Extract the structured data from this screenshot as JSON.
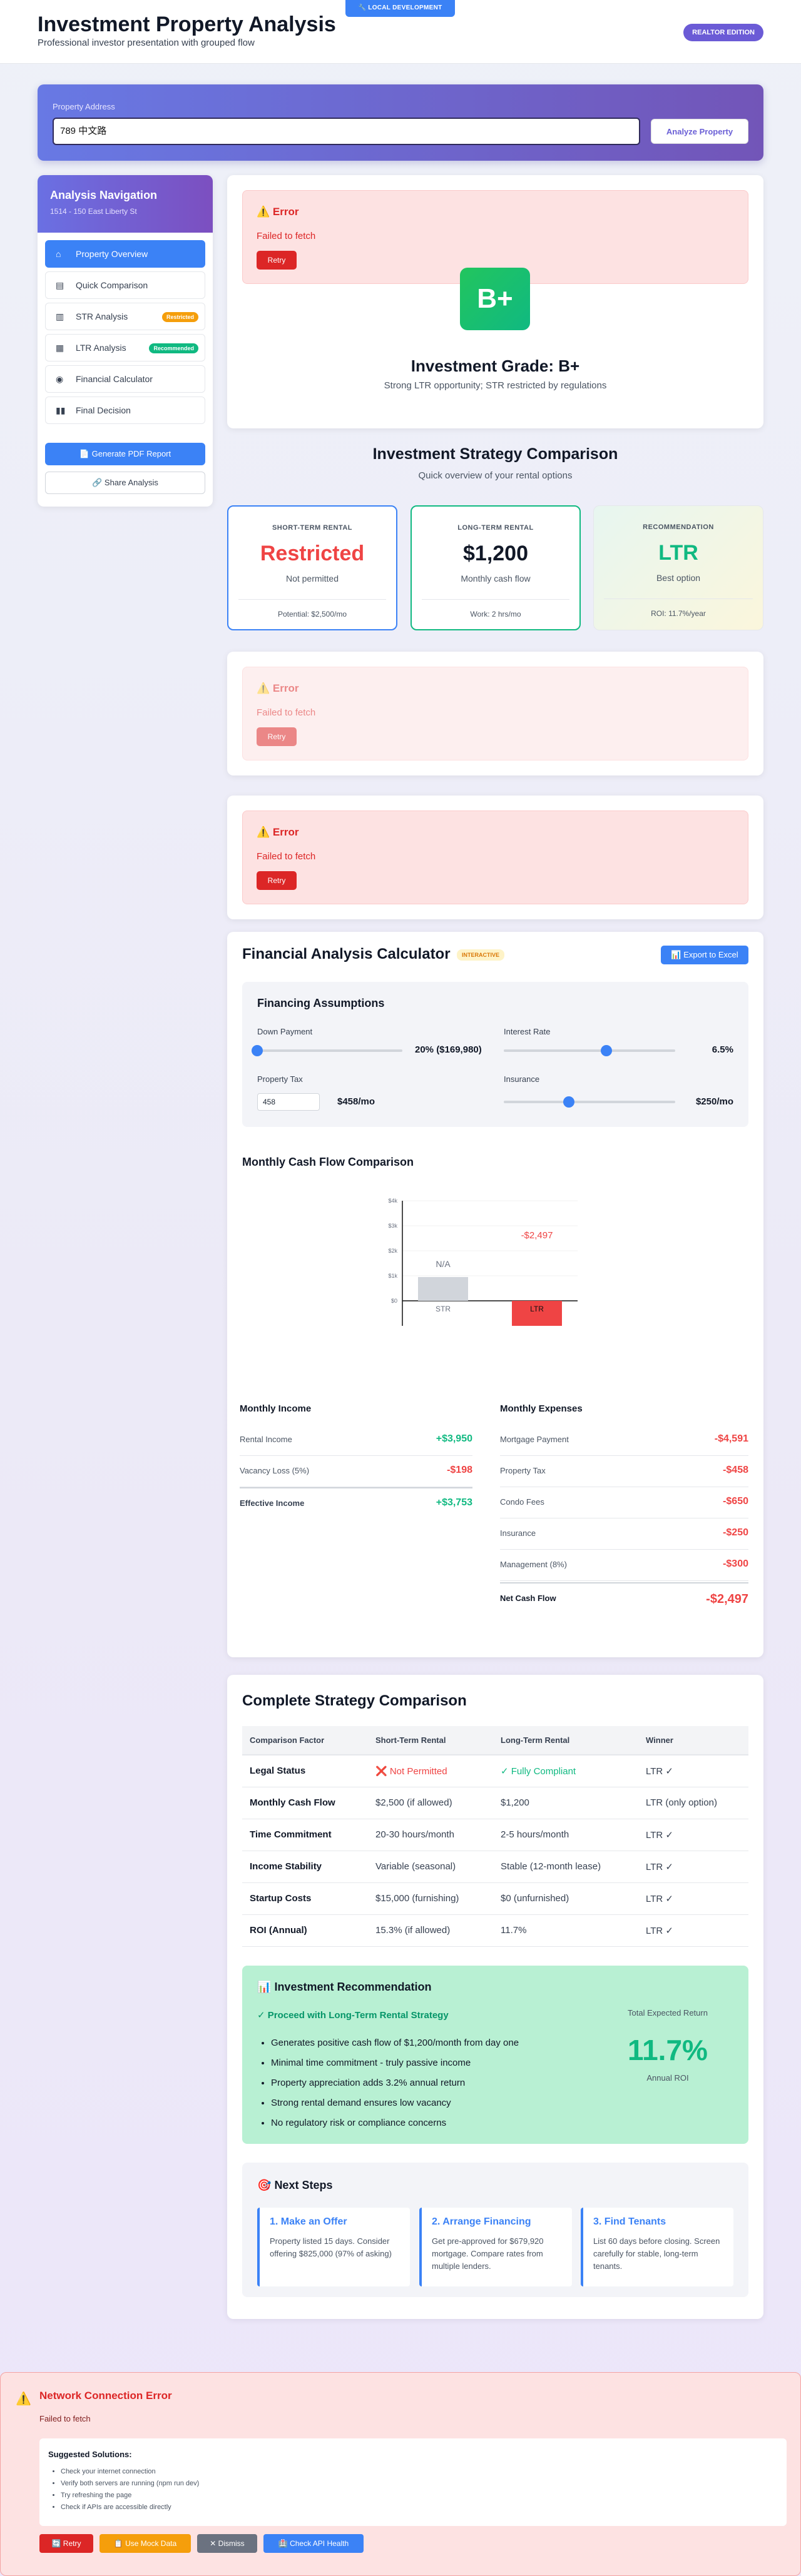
{
  "header": {
    "title": "Investment Property Analysis",
    "subtitle": "Professional investor presentation with grouped flow",
    "env_badge": "LOCAL DEVELOPMENT",
    "edition_badge": "REALTOR EDITION"
  },
  "address": {
    "label": "Property Address",
    "value": "789 中文路",
    "button": "Analyze Property"
  },
  "sidebar": {
    "title": "Analysis Navigation",
    "address": "1514 - 150 East Liberty St",
    "items": [
      {
        "label": "Property Overview",
        "icon": "home-icon",
        "badge": ""
      },
      {
        "label": "Quick Comparison",
        "icon": "clipboard-icon",
        "badge": ""
      },
      {
        "label": "STR Analysis",
        "icon": "bar-chart-icon",
        "badge": "Restricted"
      },
      {
        "label": "LTR Analysis",
        "icon": "building-icon",
        "badge": "Recommended"
      },
      {
        "label": "Financial Calculator",
        "icon": "calculator-icon",
        "badge": ""
      },
      {
        "label": "Final Decision",
        "icon": "columns-icon",
        "badge": ""
      }
    ],
    "pdf_button": "Generate PDF Report",
    "share_button": "Share Analysis"
  },
  "error": {
    "title": "Error",
    "message": "Failed to fetch",
    "retry": "Retry"
  },
  "grade": {
    "value": "B+",
    "title": "Investment Grade: B+",
    "subtitle": "Strong LTR opportunity; STR restricted by regulations"
  },
  "strategy": {
    "title": "Investment Strategy Comparison",
    "subtitle": "Quick overview of your rental options",
    "cards": [
      {
        "header": "SHORT-TERM RENTAL",
        "value": "Restricted",
        "desc": "Not permitted",
        "footer": "Potential: $2,500/mo"
      },
      {
        "header": "LONG-TERM RENTAL",
        "value": "$1,200",
        "desc": "Monthly cash flow",
        "footer": "Work: 2 hrs/mo"
      },
      {
        "header": "RECOMMENDATION",
        "value": "LTR",
        "desc": "Best option",
        "footer": "ROI: 11.7%/year"
      }
    ]
  },
  "calculator": {
    "title": "Financial Analysis Calculator",
    "tag": "INTERACTIVE",
    "export": "Export to Excel",
    "assumptions_title": "Financing Assumptions",
    "down_payment_label": "Down Payment",
    "down_payment_value": "20% ($169,980)",
    "down_payment_fraction": 0.0,
    "interest_label": "Interest Rate",
    "interest_value": "6.5%",
    "interest_fraction": 0.6,
    "tax_label": "Property Tax",
    "tax_input": "458",
    "tax_value": "$458/mo",
    "insurance_label": "Insurance",
    "insurance_value": "$250/mo",
    "insurance_fraction": 0.38,
    "chart_title": "Monthly Cash Flow Comparison"
  },
  "chart_data": {
    "type": "bar",
    "categories": [
      "STR",
      "LTR"
    ],
    "values": [
      null,
      -2497
    ],
    "data_labels": [
      "N/A",
      "-$2,497"
    ],
    "yticks": [
      "$4k",
      "$3k",
      "$2k",
      "$1k",
      "$0"
    ],
    "ylim": [
      -1000,
      4000
    ]
  },
  "income": {
    "title": "Monthly Income",
    "rows": [
      {
        "label": "Rental Income",
        "value": "+$3,950"
      },
      {
        "label": "Vacancy Loss (5%)",
        "value": "-$198"
      }
    ],
    "total_label": "Effective Income",
    "total_value": "+$3,753"
  },
  "expenses": {
    "title": "Monthly Expenses",
    "rows": [
      {
        "label": "Mortgage Payment",
        "value": "-$4,591"
      },
      {
        "label": "Property Tax",
        "value": "-$458"
      },
      {
        "label": "Condo Fees",
        "value": "-$650"
      },
      {
        "label": "Insurance",
        "value": "-$250"
      },
      {
        "label": "Management (8%)",
        "value": "-$300"
      }
    ],
    "total_label": "Net Cash Flow",
    "total_value": "-$2,497"
  },
  "comparison": {
    "title": "Complete Strategy Comparison",
    "headers": [
      "Comparison Factor",
      "Short-Term Rental",
      "Long-Term Rental",
      "Winner"
    ],
    "rows": [
      [
        "Legal Status",
        "❌ Not Permitted",
        "✓ Fully Compliant",
        "LTR ✓"
      ],
      [
        "Monthly Cash Flow",
        "$2,500 (if allowed)",
        "$1,200",
        "LTR (only option)"
      ],
      [
        "Time Commitment",
        "20-30 hours/month",
        "2-5 hours/month",
        "LTR ✓"
      ],
      [
        "Income Stability",
        "Variable (seasonal)",
        "Stable (12-month lease)",
        "LTR ✓"
      ],
      [
        "Startup Costs",
        "$15,000 (furnishing)",
        "$0 (unfurnished)",
        "LTR ✓"
      ],
      [
        "ROI (Annual)",
        "15.3% (if allowed)",
        "11.7%",
        "LTR ✓"
      ]
    ]
  },
  "recommendation": {
    "title": "Investment Recommendation",
    "proceed": "✓ Proceed with Long-Term Rental Strategy",
    "bullets": [
      "Generates positive cash flow of $1,200/month from day one",
      "Minimal time commitment - truly passive income",
      "Property appreciation adds 3.2% annual return",
      "Strong rental demand ensures low vacancy",
      "No regulatory risk or compliance concerns"
    ],
    "total_label": "Total Expected Return",
    "total_value": "11.7%",
    "total_sub": "Annual ROI"
  },
  "next_steps": {
    "title": "Next Steps",
    "steps": [
      {
        "title": "1. Make an Offer",
        "desc": "Property listed 15 days. Consider offering $825,000 (97% of asking)"
      },
      {
        "title": "2. Arrange Financing",
        "desc": "Get pre-approved for $679,920 mortgage. Compare rates from multiple lenders."
      },
      {
        "title": "3. Find Tenants",
        "desc": "List 60 days before closing. Screen carefully for stable, long-term tenants."
      }
    ]
  },
  "network_error": {
    "title": "Network Connection Error",
    "message": "Failed to fetch",
    "suggest_title": "Suggested Solutions:",
    "suggestions": [
      "Check your internet connection",
      "Verify both servers are running (npm run dev)",
      "Try refreshing the page",
      "Check if APIs are accessible directly"
    ],
    "buttons": [
      "🔄 Retry",
      "📋 Use Mock Data",
      "✕ Dismiss",
      "🏥 Check API Health"
    ]
  }
}
